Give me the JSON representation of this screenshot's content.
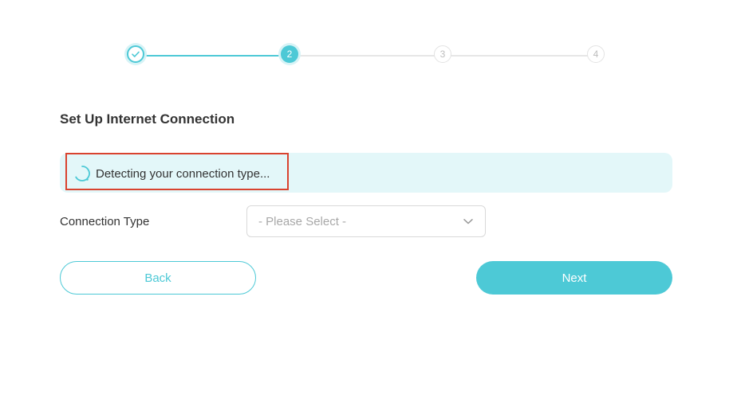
{
  "stepper": {
    "steps": [
      {
        "state": "done",
        "label": ""
      },
      {
        "state": "current",
        "label": "2"
      },
      {
        "state": "todo",
        "label": "3"
      },
      {
        "state": "todo",
        "label": "4"
      }
    ],
    "icons": {
      "done": "check-icon"
    }
  },
  "page": {
    "title": "Set Up Internet Connection"
  },
  "banner": {
    "status_text": "Detecting your connection type...",
    "icon": "loading-spinner-icon"
  },
  "connection": {
    "label": "Connection Type",
    "select_value": "- Please Select -",
    "icon": "chevron-down-icon"
  },
  "buttons": {
    "back_label": "Back",
    "next_label": "Next"
  },
  "colors": {
    "accent": "#4dc9d6",
    "banner_bg": "#e3f7f9",
    "highlight_border": "#d9432f"
  }
}
